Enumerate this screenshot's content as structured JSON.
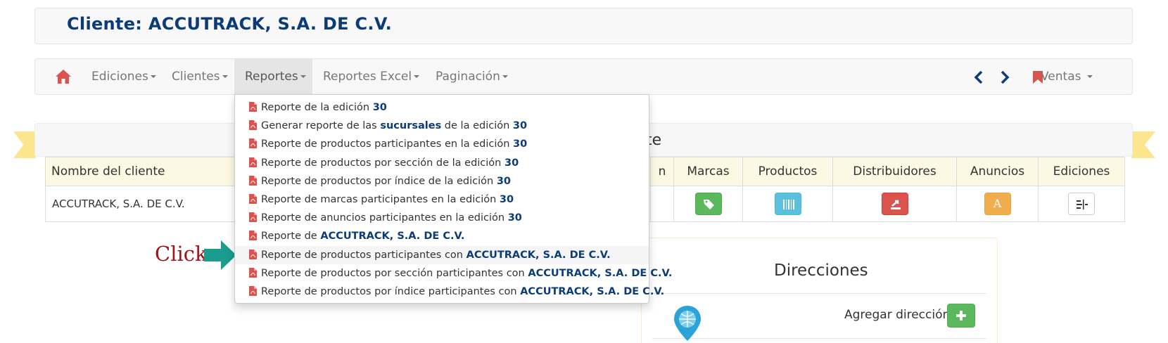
{
  "header": {
    "title": "Cliente: ACCUTRACK, S.A. DE C.V."
  },
  "navbar": {
    "items": [
      {
        "label": "Ediciones"
      },
      {
        "label": "Clientes"
      },
      {
        "label": "Reportes"
      },
      {
        "label": "Reportes Excel"
      },
      {
        "label": "Paginación"
      }
    ],
    "right_label": "Ventas"
  },
  "section": {
    "title_visible": "nte"
  },
  "table": {
    "headers": [
      "Nombre del cliente",
      "n",
      "Marcas",
      "Productos",
      "Distribuidores",
      "Anuncios",
      "Ediciones"
    ],
    "row": {
      "name": "ACCUTRACK, S.A. DE C.V.",
      "anuncios_letter": "A"
    }
  },
  "dropdown": {
    "items": [
      {
        "pre": "Reporte de la edición ",
        "bold": "30",
        "post": ""
      },
      {
        "pre": "Generar reporte de las ",
        "bold": "sucursales",
        "post": " de la edición ",
        "bold2": "30"
      },
      {
        "pre": "Reporte de productos participantes en la edición ",
        "bold": "30",
        "post": ""
      },
      {
        "pre": "Reporte de productos por sección de la edición ",
        "bold": "30",
        "post": ""
      },
      {
        "pre": "Reporte de productos por índice de la edición ",
        "bold": "30",
        "post": ""
      },
      {
        "pre": "Reporte de marcas participantes en la edición ",
        "bold": "30",
        "post": ""
      },
      {
        "pre": "Reporte de anuncios participantes en la edición ",
        "bold": "30",
        "post": ""
      },
      {
        "pre": "Reporte de ",
        "bold": "ACCUTRACK, S.A. DE C.V.",
        "post": ""
      },
      {
        "pre": "Reporte de productos participantes con ",
        "bold": "ACCUTRACK, S.A. DE C.V.",
        "post": ""
      },
      {
        "pre": "Reporte de productos por sección participantes con ",
        "bold": "ACCUTRACK, S.A. DE C.V.",
        "post": ""
      },
      {
        "pre": "Reporte de productos por índice participantes con ",
        "bold": "ACCUTRACK, S.A. DE C.V.",
        "post": ""
      }
    ]
  },
  "direcciones": {
    "title": "Direcciones",
    "add_label": "Agregar dirección"
  },
  "annotation": {
    "click": "Click"
  },
  "colors": {
    "brand": "#0c3c78",
    "home": "#d9534f",
    "highlight": "#f5f5f5",
    "ribbon": "#fbe58d",
    "arrow": "#1a9c8f"
  }
}
